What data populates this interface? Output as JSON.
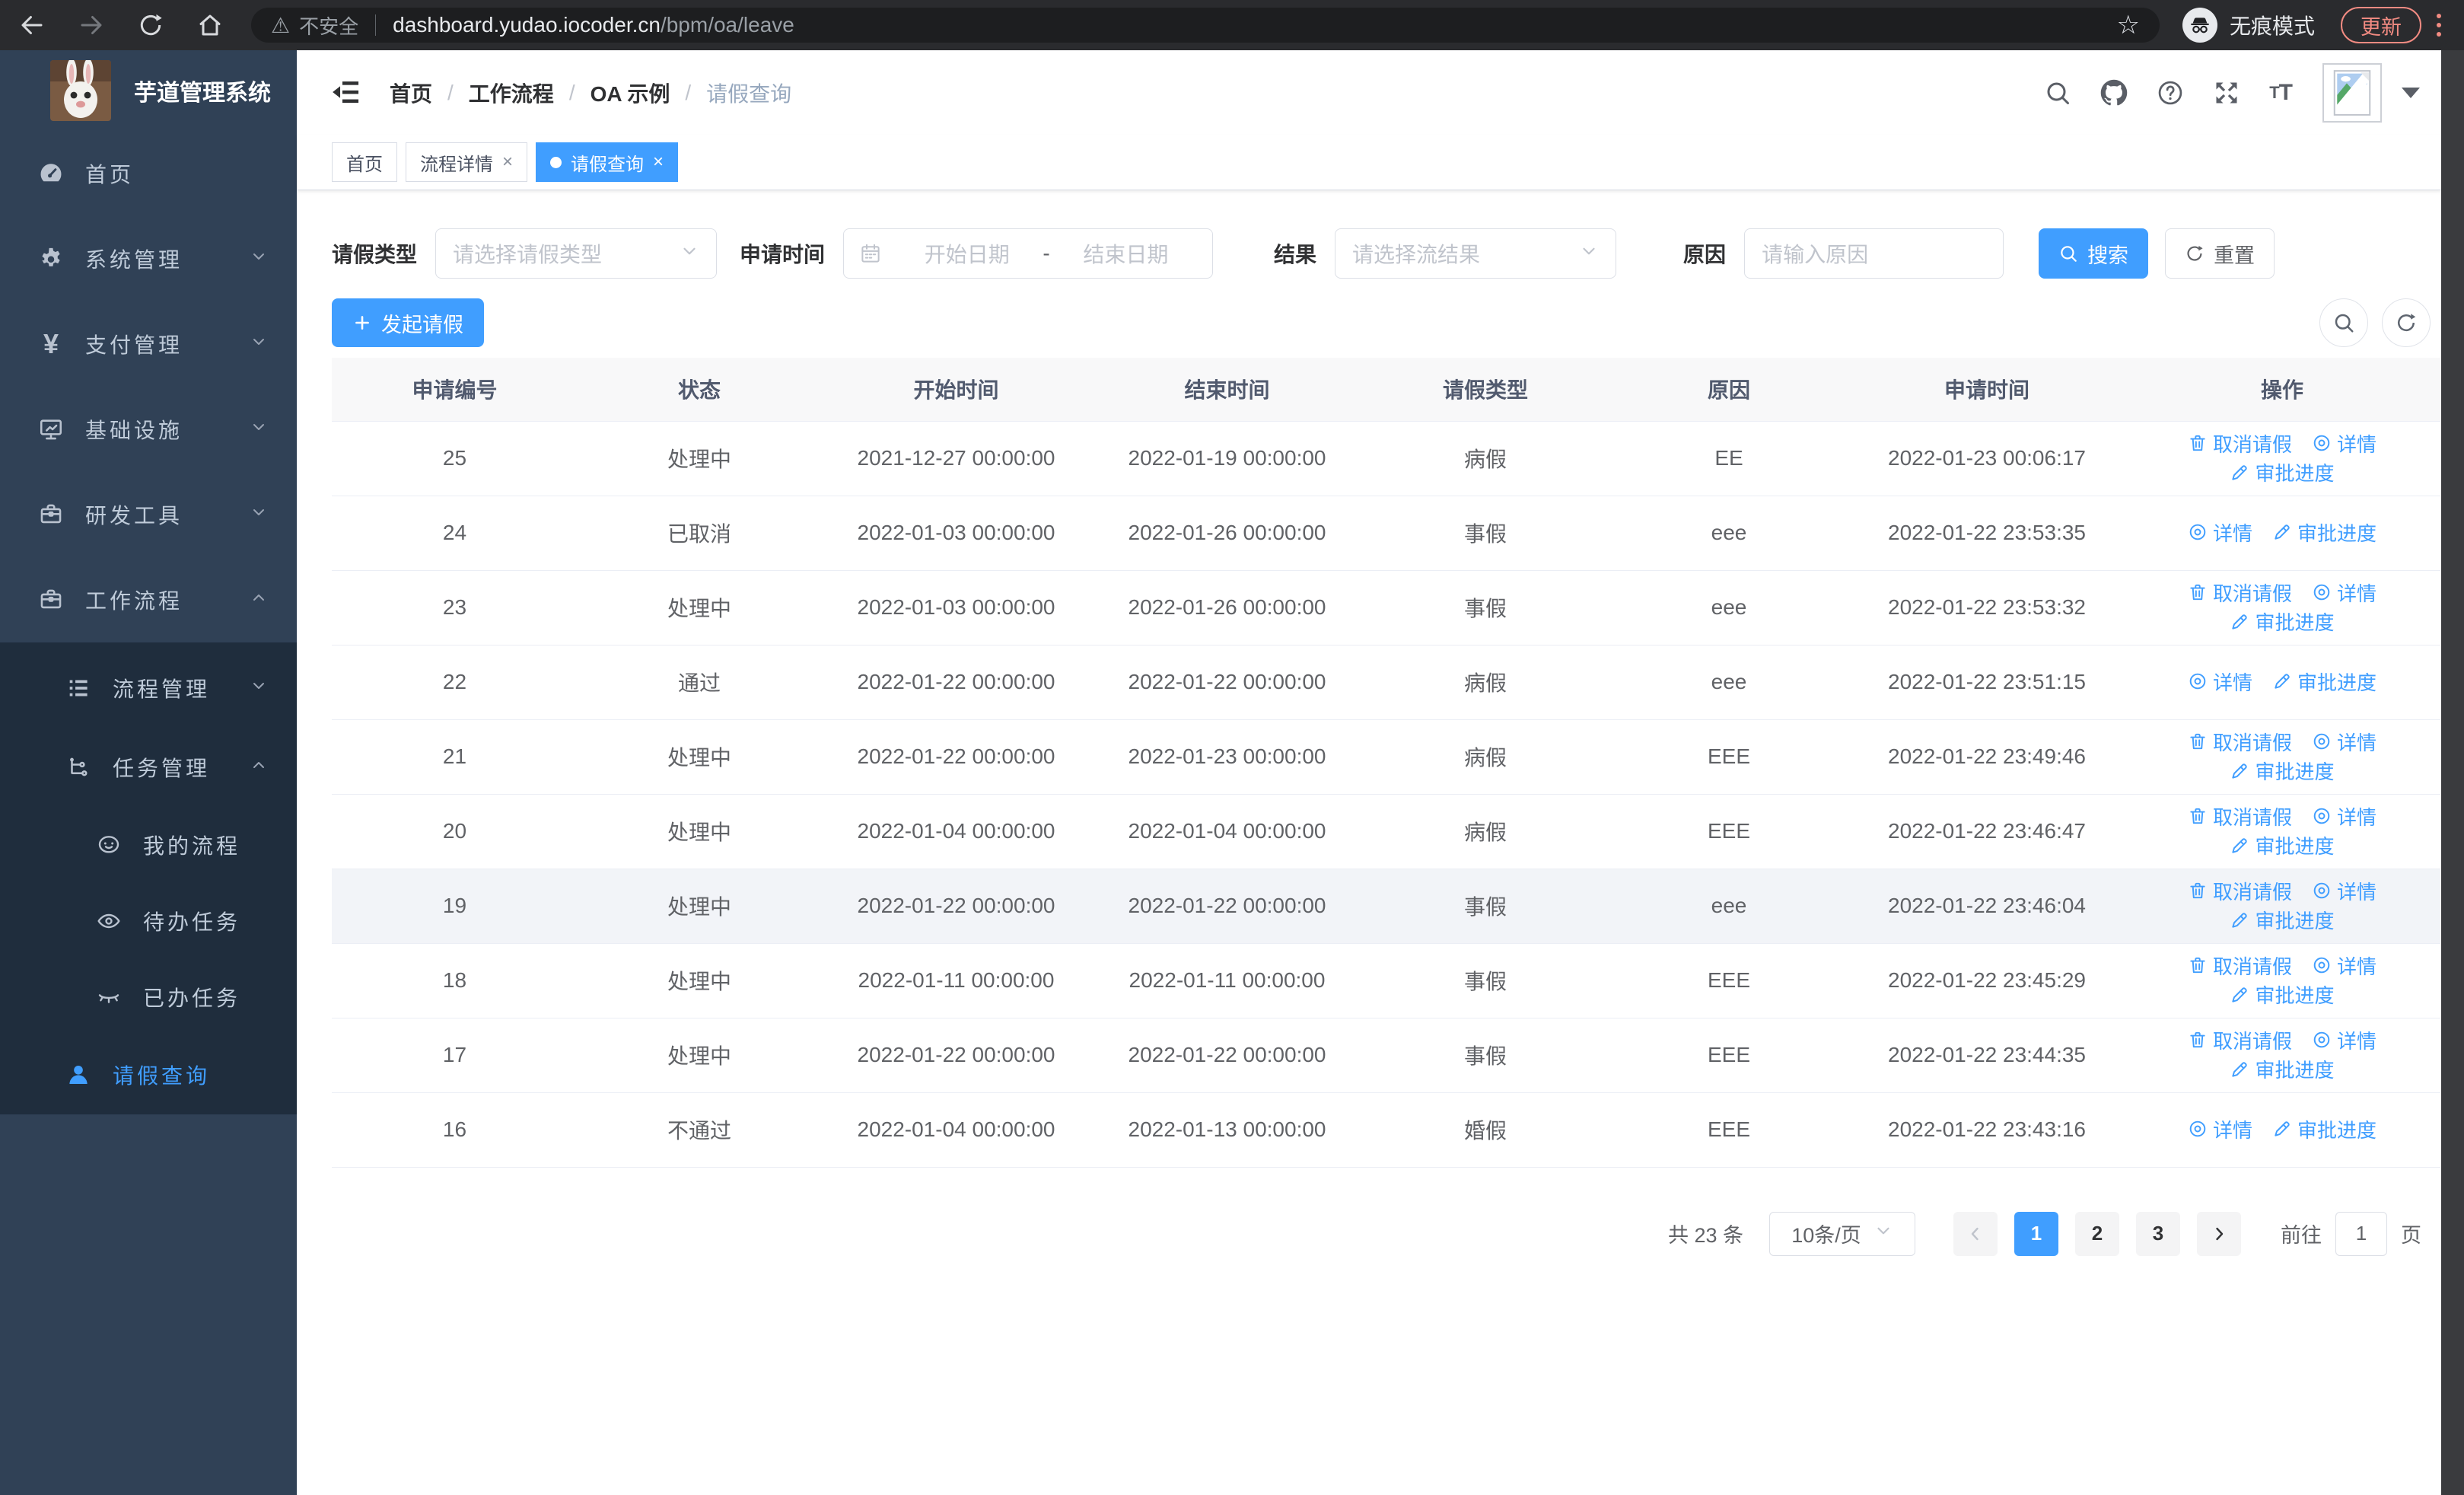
{
  "browser": {
    "security_label": "不安全",
    "url_host": "dashboard.yudao.iocoder.cn",
    "url_path": "/bpm/oa/leave",
    "incognito_label": "无痕模式",
    "update_label": "更新"
  },
  "sidebar": {
    "title": "芋道管理系统",
    "items": [
      {
        "label": "首页"
      },
      {
        "label": "系统管理"
      },
      {
        "label": "支付管理"
      },
      {
        "label": "基础设施"
      },
      {
        "label": "研发工具"
      },
      {
        "label": "工作流程"
      }
    ],
    "submenu": [
      {
        "label": "流程管理"
      },
      {
        "label": "任务管理"
      }
    ],
    "task_children": [
      {
        "label": "我的流程"
      },
      {
        "label": "待办任务"
      },
      {
        "label": "已办任务"
      }
    ],
    "active_item": {
      "label": "请假查询"
    }
  },
  "breadcrumb": {
    "separator": "/",
    "items": [
      "首页",
      "工作流程",
      "OA 示例",
      "请假查询"
    ]
  },
  "tabs": [
    {
      "label": "首页",
      "closable": false,
      "active": false
    },
    {
      "label": "流程详情",
      "closable": true,
      "active": false
    },
    {
      "label": "请假查询",
      "closable": true,
      "active": true
    }
  ],
  "filters": {
    "leave_type_label": "请假类型",
    "leave_type_placeholder": "请选择请假类型",
    "apply_time_label": "申请时间",
    "start_placeholder": "开始日期",
    "range_separator": "-",
    "end_placeholder": "结束日期",
    "result_label": "结果",
    "result_placeholder": "请选择流结果",
    "reason_label": "原因",
    "reason_placeholder": "请输入原因",
    "search_label": "搜索",
    "reset_label": "重置"
  },
  "toolbar": {
    "create_label": "发起请假"
  },
  "table": {
    "columns": [
      "申请编号",
      "状态",
      "开始时间",
      "结束时间",
      "请假类型",
      "原因",
      "申请时间",
      "操作"
    ],
    "action_labels": {
      "cancel": "取消请假",
      "detail": "详情",
      "progress": "审批进度"
    },
    "rows": [
      {
        "id": "25",
        "status": "处理中",
        "start": "2021-12-27 00:00:00",
        "end": "2022-01-19 00:00:00",
        "type": "病假",
        "reason": "EE",
        "apply_time": "2022-01-23 00:06:17",
        "actions": [
          "cancel",
          "detail",
          "progress"
        ],
        "highlighted": false
      },
      {
        "id": "24",
        "status": "已取消",
        "start": "2022-01-03 00:00:00",
        "end": "2022-01-26 00:00:00",
        "type": "事假",
        "reason": "eee",
        "apply_time": "2022-01-22 23:53:35",
        "actions": [
          "detail",
          "progress"
        ],
        "highlighted": false
      },
      {
        "id": "23",
        "status": "处理中",
        "start": "2022-01-03 00:00:00",
        "end": "2022-01-26 00:00:00",
        "type": "事假",
        "reason": "eee",
        "apply_time": "2022-01-22 23:53:32",
        "actions": [
          "cancel",
          "detail",
          "progress"
        ],
        "highlighted": false
      },
      {
        "id": "22",
        "status": "通过",
        "start": "2022-01-22 00:00:00",
        "end": "2022-01-22 00:00:00",
        "type": "病假",
        "reason": "eee",
        "apply_time": "2022-01-22 23:51:15",
        "actions": [
          "detail",
          "progress"
        ],
        "highlighted": false
      },
      {
        "id": "21",
        "status": "处理中",
        "start": "2022-01-22 00:00:00",
        "end": "2022-01-23 00:00:00",
        "type": "病假",
        "reason": "EEE",
        "apply_time": "2022-01-22 23:49:46",
        "actions": [
          "cancel",
          "detail",
          "progress"
        ],
        "highlighted": false
      },
      {
        "id": "20",
        "status": "处理中",
        "start": "2022-01-04 00:00:00",
        "end": "2022-01-04 00:00:00",
        "type": "病假",
        "reason": "EEE",
        "apply_time": "2022-01-22 23:46:47",
        "actions": [
          "cancel",
          "detail",
          "progress"
        ],
        "highlighted": false
      },
      {
        "id": "19",
        "status": "处理中",
        "start": "2022-01-22 00:00:00",
        "end": "2022-01-22 00:00:00",
        "type": "事假",
        "reason": "eee",
        "apply_time": "2022-01-22 23:46:04",
        "actions": [
          "cancel",
          "detail",
          "progress"
        ],
        "highlighted": true
      },
      {
        "id": "18",
        "status": "处理中",
        "start": "2022-01-11 00:00:00",
        "end": "2022-01-11 00:00:00",
        "type": "事假",
        "reason": "EEE",
        "apply_time": "2022-01-22 23:45:29",
        "actions": [
          "cancel",
          "detail",
          "progress"
        ],
        "highlighted": false
      },
      {
        "id": "17",
        "status": "处理中",
        "start": "2022-01-22 00:00:00",
        "end": "2022-01-22 00:00:00",
        "type": "事假",
        "reason": "EEE",
        "apply_time": "2022-01-22 23:44:35",
        "actions": [
          "cancel",
          "detail",
          "progress"
        ],
        "highlighted": false
      },
      {
        "id": "16",
        "status": "不通过",
        "start": "2022-01-04 00:00:00",
        "end": "2022-01-13 00:00:00",
        "type": "婚假",
        "reason": "EEE",
        "apply_time": "2022-01-22 23:43:16",
        "actions": [
          "detail",
          "progress"
        ],
        "highlighted": false
      }
    ]
  },
  "pagination": {
    "total_label": "共 23 条",
    "page_size_label": "10条/页",
    "pages": [
      "1",
      "2",
      "3"
    ],
    "active_page": "1",
    "goto_label": "前往",
    "goto_value": "1",
    "page_unit": "页"
  },
  "colors": {
    "accent": "#409eff",
    "sidebar_bg": "#304156",
    "sidebar_submenu_bg": "#1f2d3d",
    "update_accent": "#f28b82"
  }
}
